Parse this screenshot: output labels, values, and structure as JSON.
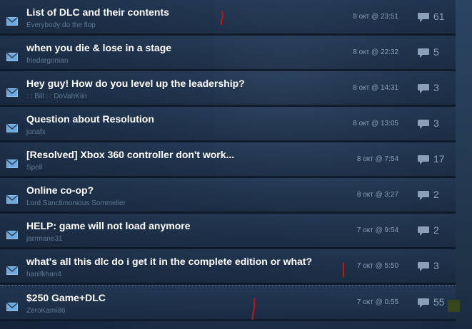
{
  "topics": [
    {
      "title": "List of DLC and their contents",
      "author": "Everybody do the flop",
      "date": "8 окт @ 23:51",
      "replies": "61"
    },
    {
      "title": "when you die & lose in a stage",
      "author": "friedargonian",
      "date": "8 окт @ 22:32",
      "replies": "5"
    },
    {
      "title": "Hey guy! How do you level up the leadership?",
      "author": ": : Bill : : DoVahKiin",
      "date": "8 окт @ 14:31",
      "replies": "3"
    },
    {
      "title": "Question about Resolution",
      "author": "jonafx",
      "date": "8 окт @ 13:05",
      "replies": "3"
    },
    {
      "title": "[Resolved] Xbox 360 controller don't work...",
      "author": "Spell",
      "date": "8 окт @ 7:54",
      "replies": "17"
    },
    {
      "title": "Online co-op?",
      "author": "Lord Sanctimonious Sommelier",
      "date": "8 окт @ 3:27",
      "replies": "2"
    },
    {
      "title": "HELP: game will not load anymore",
      "author": "jarrmane31",
      "date": "7 окт @ 9:54",
      "replies": "2"
    },
    {
      "title": "what's all this dlc do i get it in the complete edition or what?",
      "author": "hanifkhan4",
      "date": "7 окт @ 5:50",
      "replies": "3"
    },
    {
      "title": "$250 Game+DLC",
      "author": "ZeroKami86",
      "date": "7 окт @ 0:55",
      "replies": "55"
    }
  ],
  "icons": {
    "unread": "envelope-icon",
    "replies": "comment-bubble-icon"
  },
  "colors": {
    "title": "#ffffff",
    "author": "#5e7a96",
    "meta": "#8aa0b8",
    "envelope": "#6fa8dc",
    "annotation_mark": "#d01010"
  }
}
